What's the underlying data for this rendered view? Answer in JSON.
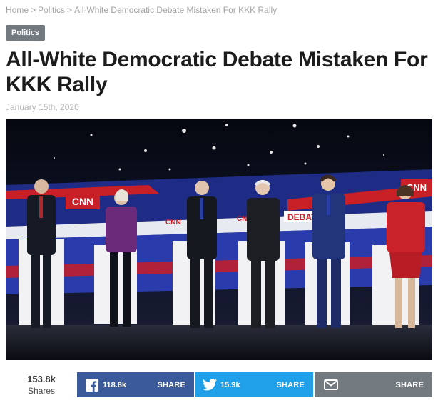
{
  "breadcrumb": {
    "home": "Home",
    "separator": ">",
    "section": "Politics",
    "current": "All-White Democratic Debate Mistaken For KKK Rally"
  },
  "category_badge": "Politics",
  "headline": "All-White Democratic Debate Mistaken For KKK Rally",
  "date": "January 15th, 2020",
  "hero_image": {
    "stage_text": [
      "CNN",
      "CNN",
      "DEBATE",
      "CNN",
      "CNN"
    ]
  },
  "share_bar": {
    "total_count": "153.8k",
    "total_label": "Shares",
    "facebook": {
      "icon": "facebook-icon",
      "count": "118.8k",
      "action": "SHARE",
      "color": "#3b5a9a"
    },
    "twitter": {
      "icon": "twitter-icon",
      "count": "15.9k",
      "action": "SHARE",
      "color": "#1fa0e8"
    },
    "email": {
      "icon": "envelope-icon",
      "action": "SHARE",
      "color": "#727a80"
    }
  }
}
